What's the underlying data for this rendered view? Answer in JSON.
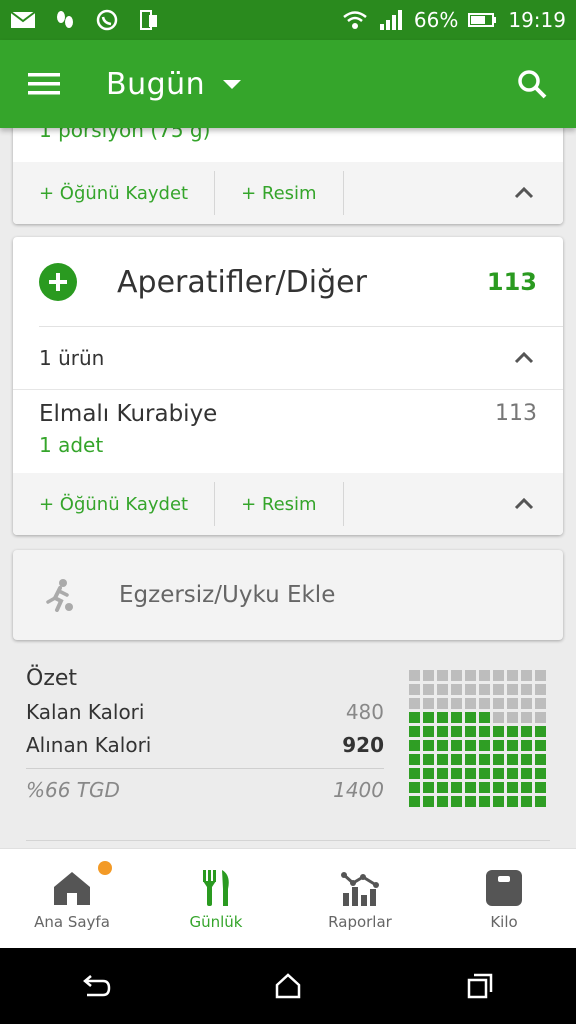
{
  "status_bar": {
    "battery_percent": "66%",
    "time": "19:19",
    "icons": [
      "mail-icon",
      "steps-icon",
      "whatsapp-icon",
      "phone-icon",
      "wifi-icon",
      "signal-icon",
      "battery-icon"
    ]
  },
  "app_bar": {
    "title": "Bugün"
  },
  "previous_card": {
    "partial_text": "1 porsiyon (75 g)",
    "save_meal": "+ Öğünü Kaydet",
    "add_photo": "+ Resim"
  },
  "snacks_card": {
    "title": "Aperatifler/Diğer",
    "calories": "113",
    "item_count": "1 ürün",
    "items": [
      {
        "name": "Elmalı Kurabiye",
        "amount": "1  adet",
        "calories": "113"
      }
    ],
    "save_meal": "+ Öğünü Kaydet",
    "add_photo": "+ Resim"
  },
  "exercise": {
    "label": "Egzersiz/Uyku Ekle"
  },
  "summary": {
    "title": "Özet",
    "remaining_label": "Kalan Kalori",
    "remaining_value": "480",
    "consumed_label": "Alınan Kalori",
    "consumed_value": "920",
    "tgd_label": "%66 TGD",
    "tgd_value": "1400",
    "grid_filled_fraction": 0.66
  },
  "bottom_nav": {
    "items": [
      {
        "label": "Ana Sayfa",
        "icon": "home-icon"
      },
      {
        "label": "Günlük",
        "icon": "fork-knife-icon"
      },
      {
        "label": "Raporlar",
        "icon": "reports-icon"
      },
      {
        "label": "Kilo",
        "icon": "scale-icon"
      }
    ]
  },
  "colors": {
    "primary": "#35a52b",
    "status_bar": "#2a8a1e",
    "badge": "#f39a26"
  }
}
